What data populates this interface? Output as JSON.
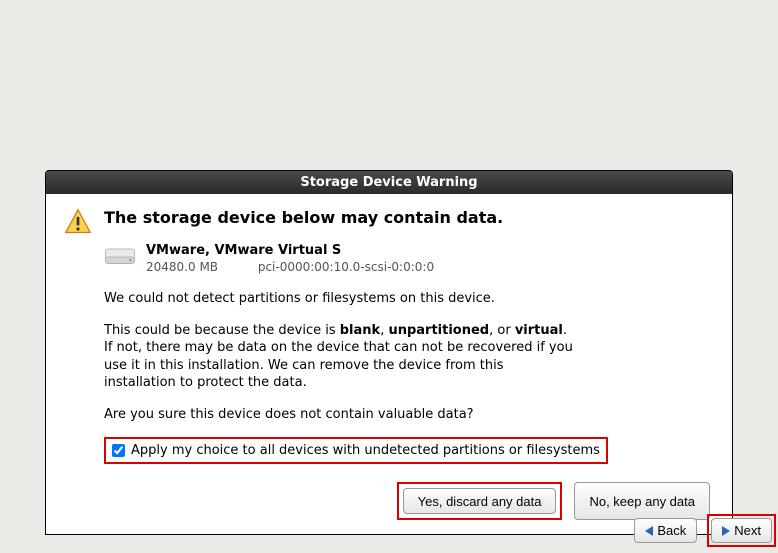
{
  "dialog": {
    "title": "Storage Device Warning",
    "heading": "The storage device below may contain data.",
    "device": {
      "name": "VMware, VMware Virtual S",
      "size": "20480.0 MB",
      "path": "pci-0000:00:10.0-scsi-0:0:0:0"
    },
    "line_nodetect": "We could not detect partitions or filesystems on this device.",
    "para2_prefix": "This could be because the device is ",
    "bold_blank": "blank",
    "comma": ", ",
    "bold_unpart": "unpartitioned",
    "or_text": ", or ",
    "bold_virtual": "virtual",
    "para2_suffix": ". If not, there may be data on the device that can not be recovered if you use it in this installation. We can remove the device from this installation to protect the data.",
    "confirm_q": "Are you sure this device does not contain valuable data?",
    "checkbox_label": "Apply my choice to all devices with undetected partitions or filesystems",
    "checkbox_checked": true,
    "btn_yes": "Yes, discard any data",
    "btn_no": "No, keep any data"
  },
  "nav": {
    "back": "Back",
    "next": "Next"
  }
}
